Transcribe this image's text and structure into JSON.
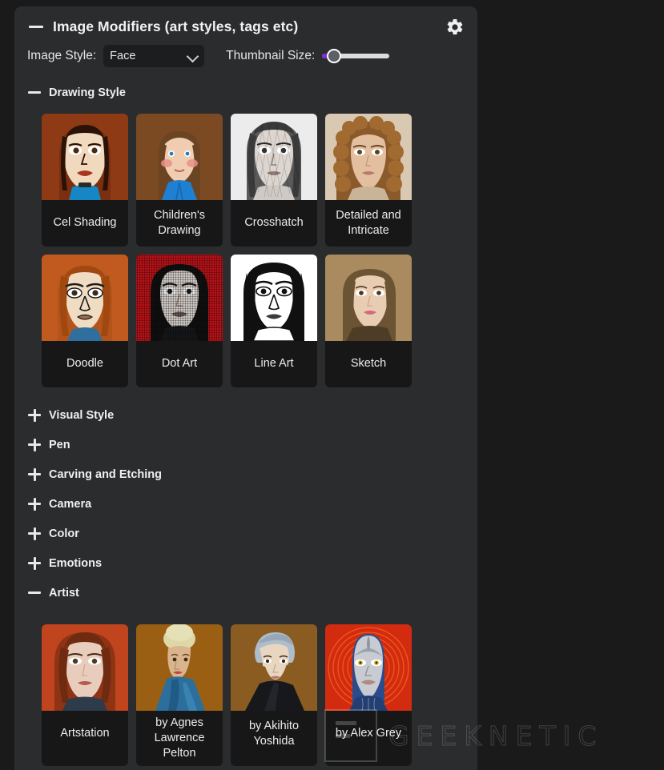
{
  "watermark": {
    "text": "GEEKNETIC"
  },
  "panel": {
    "title": "Image Modifiers (art styles, tags etc)",
    "collapse_icon": "minus-icon",
    "settings_icon": "gear-icon"
  },
  "controls": {
    "image_style_label": "Image Style:",
    "image_style_value": "Face",
    "image_style_options": [
      "Face"
    ],
    "thumbnail_size_label": "Thumbnail Size:",
    "thumbnail_size_value": 12,
    "slider_accent": "#7b2fd6"
  },
  "sections": [
    {
      "name": "Drawing Style",
      "expanded": true,
      "icon": "minus-icon"
    },
    {
      "name": "Visual Style",
      "expanded": false,
      "icon": "plus-icon"
    },
    {
      "name": "Pen",
      "expanded": false,
      "icon": "plus-icon"
    },
    {
      "name": "Carving and Etching",
      "expanded": false,
      "icon": "plus-icon"
    },
    {
      "name": "Camera",
      "expanded": false,
      "icon": "plus-icon"
    },
    {
      "name": "Color",
      "expanded": false,
      "icon": "plus-icon"
    },
    {
      "name": "Emotions",
      "expanded": false,
      "icon": "plus-icon"
    },
    {
      "name": "Artist",
      "expanded": true,
      "icon": "minus-icon"
    }
  ],
  "drawing_style_items": [
    {
      "label": "Cel Shading"
    },
    {
      "label": "Children's Drawing"
    },
    {
      "label": "Crosshatch"
    },
    {
      "label": "Detailed and Intricate"
    },
    {
      "label": "Doodle"
    },
    {
      "label": "Dot Art"
    },
    {
      "label": "Line Art"
    },
    {
      "label": "Sketch"
    }
  ],
  "artist_items": [
    {
      "label": "Artstation"
    },
    {
      "label": "by Agnes Lawrence Pelton"
    },
    {
      "label": "by Akihito Yoshida"
    },
    {
      "label": "by Alex Grey"
    }
  ],
  "colors": {
    "page_background": "#1a1a1b",
    "panel_background": "#2a2c2e",
    "card_background": "#171717",
    "text_primary": "#f2f2f2",
    "accent": "#7b2fd6"
  }
}
